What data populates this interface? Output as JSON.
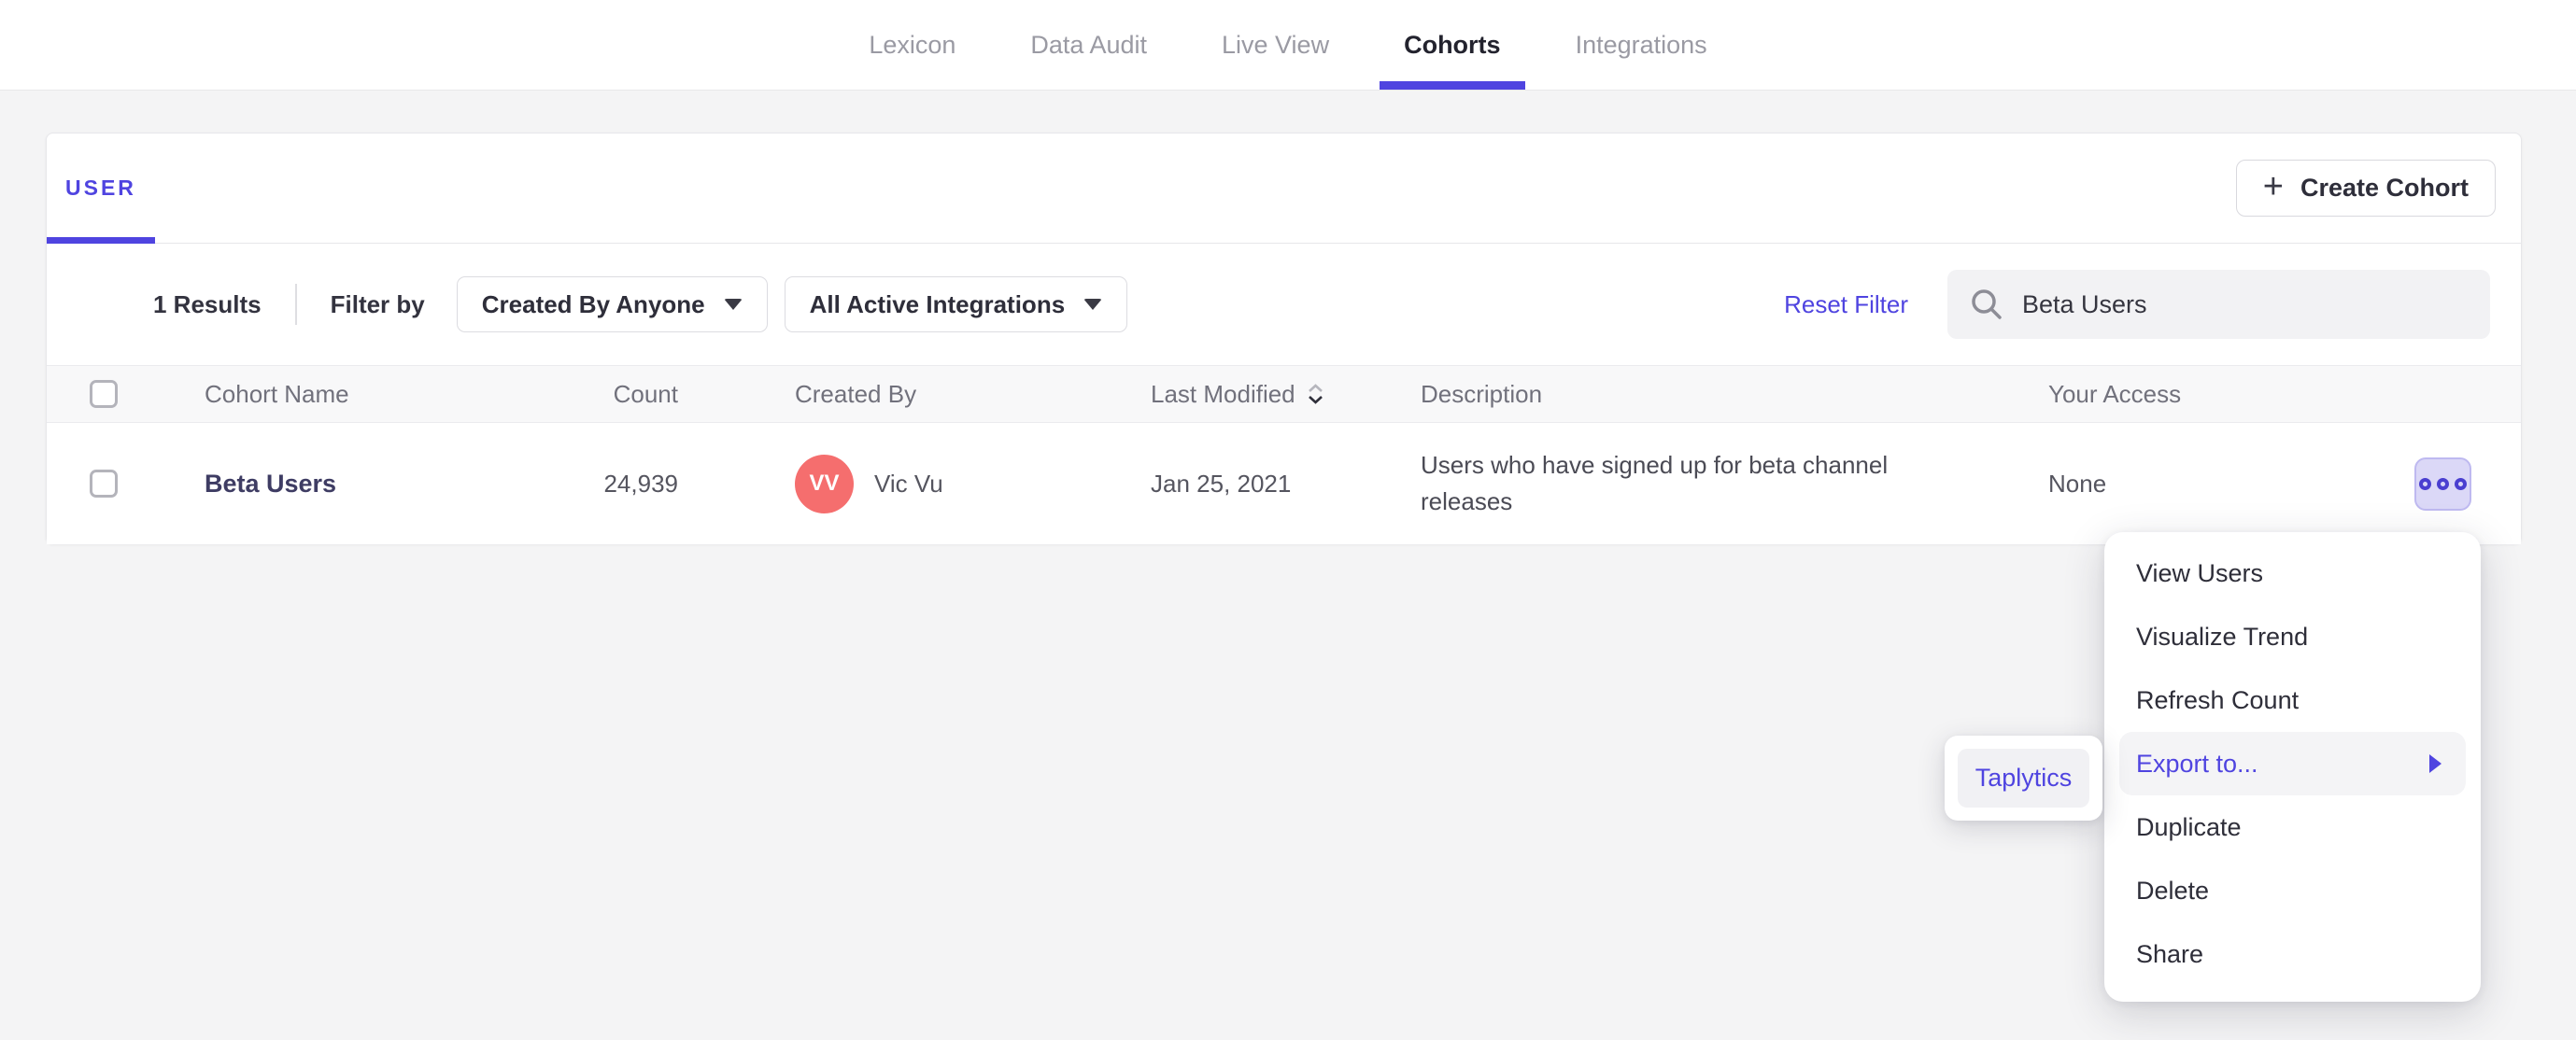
{
  "nav": {
    "items": [
      {
        "label": "Lexicon",
        "active": false
      },
      {
        "label": "Data Audit",
        "active": false
      },
      {
        "label": "Live View",
        "active": false
      },
      {
        "label": "Cohorts",
        "active": true
      },
      {
        "label": "Integrations",
        "active": false
      }
    ]
  },
  "card": {
    "tabs": {
      "user_label": "USER"
    },
    "create_button": {
      "plus": "+",
      "label": "Create Cohort"
    },
    "filters": {
      "results": "1 Results",
      "filter_by": "Filter by",
      "created_by_value": "Created By Anyone",
      "integrations_value": "All Active Integrations",
      "reset_label": "Reset Filter",
      "search_value": "Beta Users"
    },
    "table": {
      "headers": {
        "name": "Cohort Name",
        "count": "Count",
        "created_by": "Created By",
        "last_modified": "Last Modified",
        "description": "Description",
        "access": "Your Access"
      },
      "rows": [
        {
          "name": "Beta Users",
          "count": "24,939",
          "creator_initials": "VV",
          "creator_name": "Vic Vu",
          "last_modified": "Jan 25, 2021",
          "description": "Users who have signed up for beta channel releases",
          "access": "None"
        }
      ]
    }
  },
  "context_menu": {
    "items": [
      "View Users",
      "Visualize Trend",
      "Refresh Count",
      "Export to...",
      "Duplicate",
      "Delete",
      "Share"
    ],
    "highlighted_item": "Export to...",
    "submenu_items": [
      "Taplytics"
    ]
  },
  "colors": {
    "accent": "#4f44e0",
    "avatar": "#f56e6e",
    "more_button_bg": "#dbd8f7",
    "more_button_glyph": "#4a3fd0"
  }
}
